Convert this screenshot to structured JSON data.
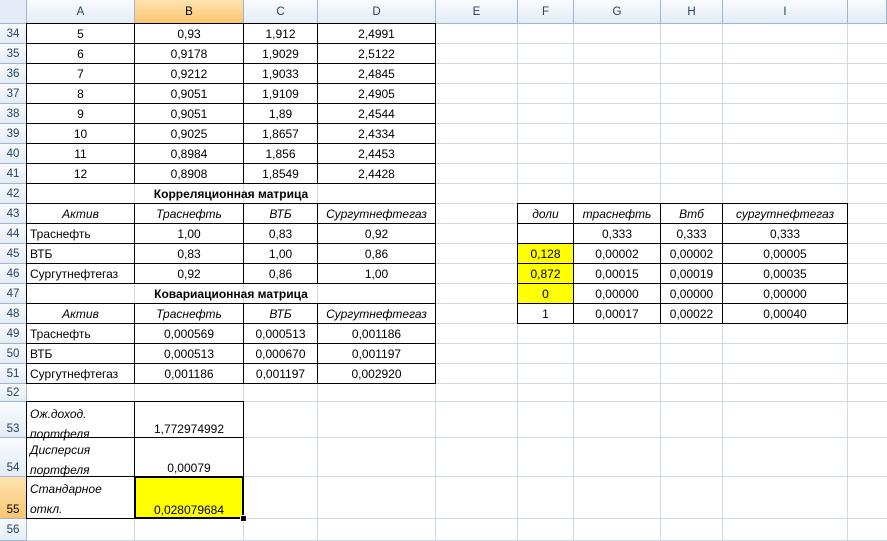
{
  "columns": [
    "A",
    "B",
    "C",
    "D",
    "E",
    "F",
    "G",
    "H",
    "I"
  ],
  "selected_column": "B",
  "selected_row": "55",
  "rows": [
    "34",
    "35",
    "36",
    "37",
    "38",
    "39",
    "40",
    "41",
    "42",
    "43",
    "44",
    "45",
    "46",
    "47",
    "48",
    "49",
    "50",
    "51",
    "52",
    "53",
    "54",
    "55",
    "56"
  ],
  "monthly_table": [
    {
      "n": "5",
      "b": "0,93",
      "c": "1,912",
      "d": "2,4991"
    },
    {
      "n": "6",
      "b": "0,9178",
      "c": "1,9029",
      "d": "2,5122"
    },
    {
      "n": "7",
      "b": "0,9212",
      "c": "1,9033",
      "d": "2,4845"
    },
    {
      "n": "8",
      "b": "0,9051",
      "c": "1,9109",
      "d": "2,4905"
    },
    {
      "n": "9",
      "b": "0,9051",
      "c": "1,89",
      "d": "2,4544"
    },
    {
      "n": "10",
      "b": "0,9025",
      "c": "1,8657",
      "d": "2,4334"
    },
    {
      "n": "11",
      "b": "0,8984",
      "c": "1,856",
      "d": "2,4453"
    },
    {
      "n": "12",
      "b": "0,8908",
      "c": "1,8549",
      "d": "2,4428"
    }
  ],
  "correlation": {
    "title": "Корреляционная матрица",
    "headers": [
      "Актив",
      "Траснефть",
      "ВТБ",
      "Сургутнефтегаз"
    ],
    "rows": [
      [
        "Траснефть",
        "1,00",
        "0,83",
        "0,92"
      ],
      [
        "ВТБ",
        "0,83",
        "1,00",
        "0,86"
      ],
      [
        "Сургутнефтегаз",
        "0,92",
        "0,86",
        "1,00"
      ]
    ]
  },
  "covariance": {
    "title": "Ковариационная матрица",
    "headers": [
      "Актив",
      "Траснефть",
      "ВТБ",
      "Сургутнефтегаз"
    ],
    "rows": [
      [
        "Траснефть",
        "0,000569",
        "0,000513",
        "0,001186"
      ],
      [
        "ВТБ",
        "0,000513",
        "0,000670",
        "0,001197"
      ],
      [
        "Сургутнефтегаз",
        "0,001186",
        "0,001197",
        "0,002920"
      ]
    ]
  },
  "portfolio": {
    "expected_return_label_1": "Ож.доход.",
    "expected_return_label_2": "портфеля",
    "expected_return_value": "1,772974992",
    "variance_label_1": "Дисперсия",
    "variance_label_2": "портфеля",
    "variance_value": "0,00079",
    "stdev_label_1": "Стандарное",
    "stdev_label_2": "откл.",
    "stdev_value": "0,028079684"
  },
  "weights": {
    "headers": [
      "доли",
      "траснефть",
      "Втб",
      "сургутнефтегаз"
    ],
    "rows": [
      [
        "",
        "0,333",
        "0,333",
        "0,333"
      ],
      [
        "0,128",
        "0,00002",
        "0,00002",
        "0,00005"
      ],
      [
        "0,872",
        "0,00015",
        "0,00019",
        "0,00035"
      ],
      [
        "0",
        "0,00000",
        "0,00000",
        "0,00000"
      ],
      [
        "1",
        "0,00017",
        "0,00022",
        "0,00040"
      ]
    ]
  },
  "colors": {
    "highlight": "#ffff00",
    "header_bg": "#e4ecf7",
    "selected_header_bg": "#f9c66f",
    "gridline": "#d0d7e5"
  }
}
